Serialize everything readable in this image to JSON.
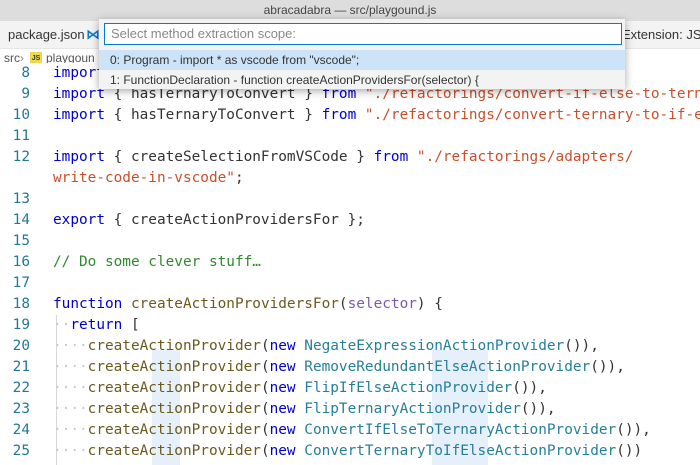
{
  "window": {
    "title": "abracadabra — src/playgound.js"
  },
  "tabs": {
    "package": "package.json",
    "vscode_icon": "⋈",
    "right": "Extension: JS"
  },
  "breadcrumb": {
    "folder": "src",
    "sep": "›",
    "js_icon": "JS",
    "file": "playgoun"
  },
  "quickpick": {
    "placeholder": "Select method extraction scope:",
    "items": [
      "0: Program - import * as vscode from \"vscode\";",
      "1: FunctionDeclaration - function createActionProvidersFor(selector) {"
    ]
  },
  "editor": {
    "lines": [
      {
        "num": "8",
        "tokens": [
          [
            "kw",
            "import"
          ]
        ]
      },
      {
        "num": "9",
        "tokens": [
          [
            "kw",
            "import"
          ],
          [
            "p",
            " { hasTernaryToConvert } "
          ],
          [
            "kw",
            "from"
          ],
          [
            "p",
            " "
          ],
          [
            "str",
            "\"./refactorings/convert-if-else-to-ternary\""
          ]
        ]
      },
      {
        "num": "10",
        "tokens": [
          [
            "kw",
            "import"
          ],
          [
            "p",
            " { hasTernaryToConvert } "
          ],
          [
            "kw",
            "from"
          ],
          [
            "p",
            " "
          ],
          [
            "str",
            "\"./refactorings/convert-ternary-to-if-else\""
          ]
        ]
      },
      {
        "num": "11",
        "tokens": []
      },
      {
        "num": "12",
        "tokens": [
          [
            "kw",
            "import"
          ],
          [
            "p",
            " { createSelectionFromVSCode } "
          ],
          [
            "kw",
            "from"
          ],
          [
            "p",
            " "
          ],
          [
            "str",
            "\"./refactorings/adapters/"
          ]
        ]
      },
      {
        "num": "",
        "tokens": [
          [
            "str",
            "write-code-in-vscode\""
          ],
          [
            "p",
            ";"
          ]
        ]
      },
      {
        "num": "13",
        "tokens": []
      },
      {
        "num": "14",
        "tokens": [
          [
            "kw",
            "export"
          ],
          [
            "p",
            " { createActionProvidersFor };"
          ]
        ]
      },
      {
        "num": "15",
        "tokens": []
      },
      {
        "num": "16",
        "tokens": [
          [
            "cm",
            "// Do some clever stuff…"
          ]
        ]
      },
      {
        "num": "17",
        "tokens": []
      },
      {
        "num": "18",
        "tokens": [
          [
            "kw",
            "function"
          ],
          [
            "p",
            " "
          ],
          [
            "fn",
            "createActionProvidersFor"
          ],
          [
            "p",
            "("
          ],
          [
            "param",
            "selector"
          ],
          [
            "p",
            ") {"
          ]
        ]
      },
      {
        "num": "19",
        "tokens": [
          [
            "ws",
            "··"
          ],
          [
            "kw",
            "return"
          ],
          [
            "p",
            " ["
          ]
        ]
      },
      {
        "num": "20",
        "tokens": [
          [
            "ws",
            "····"
          ],
          [
            "fn",
            "createActionProvider"
          ],
          [
            "p",
            "("
          ],
          [
            "kw",
            "new"
          ],
          [
            "p",
            " "
          ],
          [
            "type",
            "NegateExpressionActionProvider"
          ],
          [
            "p",
            "()),"
          ]
        ]
      },
      {
        "num": "21",
        "tokens": [
          [
            "ws",
            "····"
          ],
          [
            "fn",
            "createActionProvider"
          ],
          [
            "p",
            "("
          ],
          [
            "kw",
            "new"
          ],
          [
            "p",
            " "
          ],
          [
            "type",
            "RemoveRedundantElseActionProvider"
          ],
          [
            "p",
            "()),"
          ]
        ]
      },
      {
        "num": "22",
        "tokens": [
          [
            "ws",
            "····"
          ],
          [
            "fn",
            "createActionProvider"
          ],
          [
            "p",
            "("
          ],
          [
            "kw",
            "new"
          ],
          [
            "p",
            " "
          ],
          [
            "type",
            "FlipIfElseActionProvider"
          ],
          [
            "p",
            "()),"
          ]
        ]
      },
      {
        "num": "23",
        "tokens": [
          [
            "ws",
            "····"
          ],
          [
            "fn",
            "createActionProvider"
          ],
          [
            "p",
            "("
          ],
          [
            "kw",
            "new"
          ],
          [
            "p",
            " "
          ],
          [
            "type",
            "FlipTernaryActionProvider"
          ],
          [
            "p",
            "()),"
          ]
        ]
      },
      {
        "num": "24",
        "tokens": [
          [
            "ws",
            "····"
          ],
          [
            "fn",
            "createActionProvider"
          ],
          [
            "p",
            "("
          ],
          [
            "kw",
            "new"
          ],
          [
            "p",
            " "
          ],
          [
            "type",
            "ConvertIfElseToTernaryActionProvider"
          ],
          [
            "p",
            "()),"
          ]
        ]
      },
      {
        "num": "25",
        "tokens": [
          [
            "ws",
            "····"
          ],
          [
            "fn",
            "createActionProvider"
          ],
          [
            "p",
            "("
          ],
          [
            "kw",
            "new"
          ],
          [
            "p",
            " "
          ],
          [
            "type",
            "ConvertTernaryToIfElseActionProvider"
          ],
          [
            "p",
            "())"
          ]
        ]
      }
    ]
  }
}
